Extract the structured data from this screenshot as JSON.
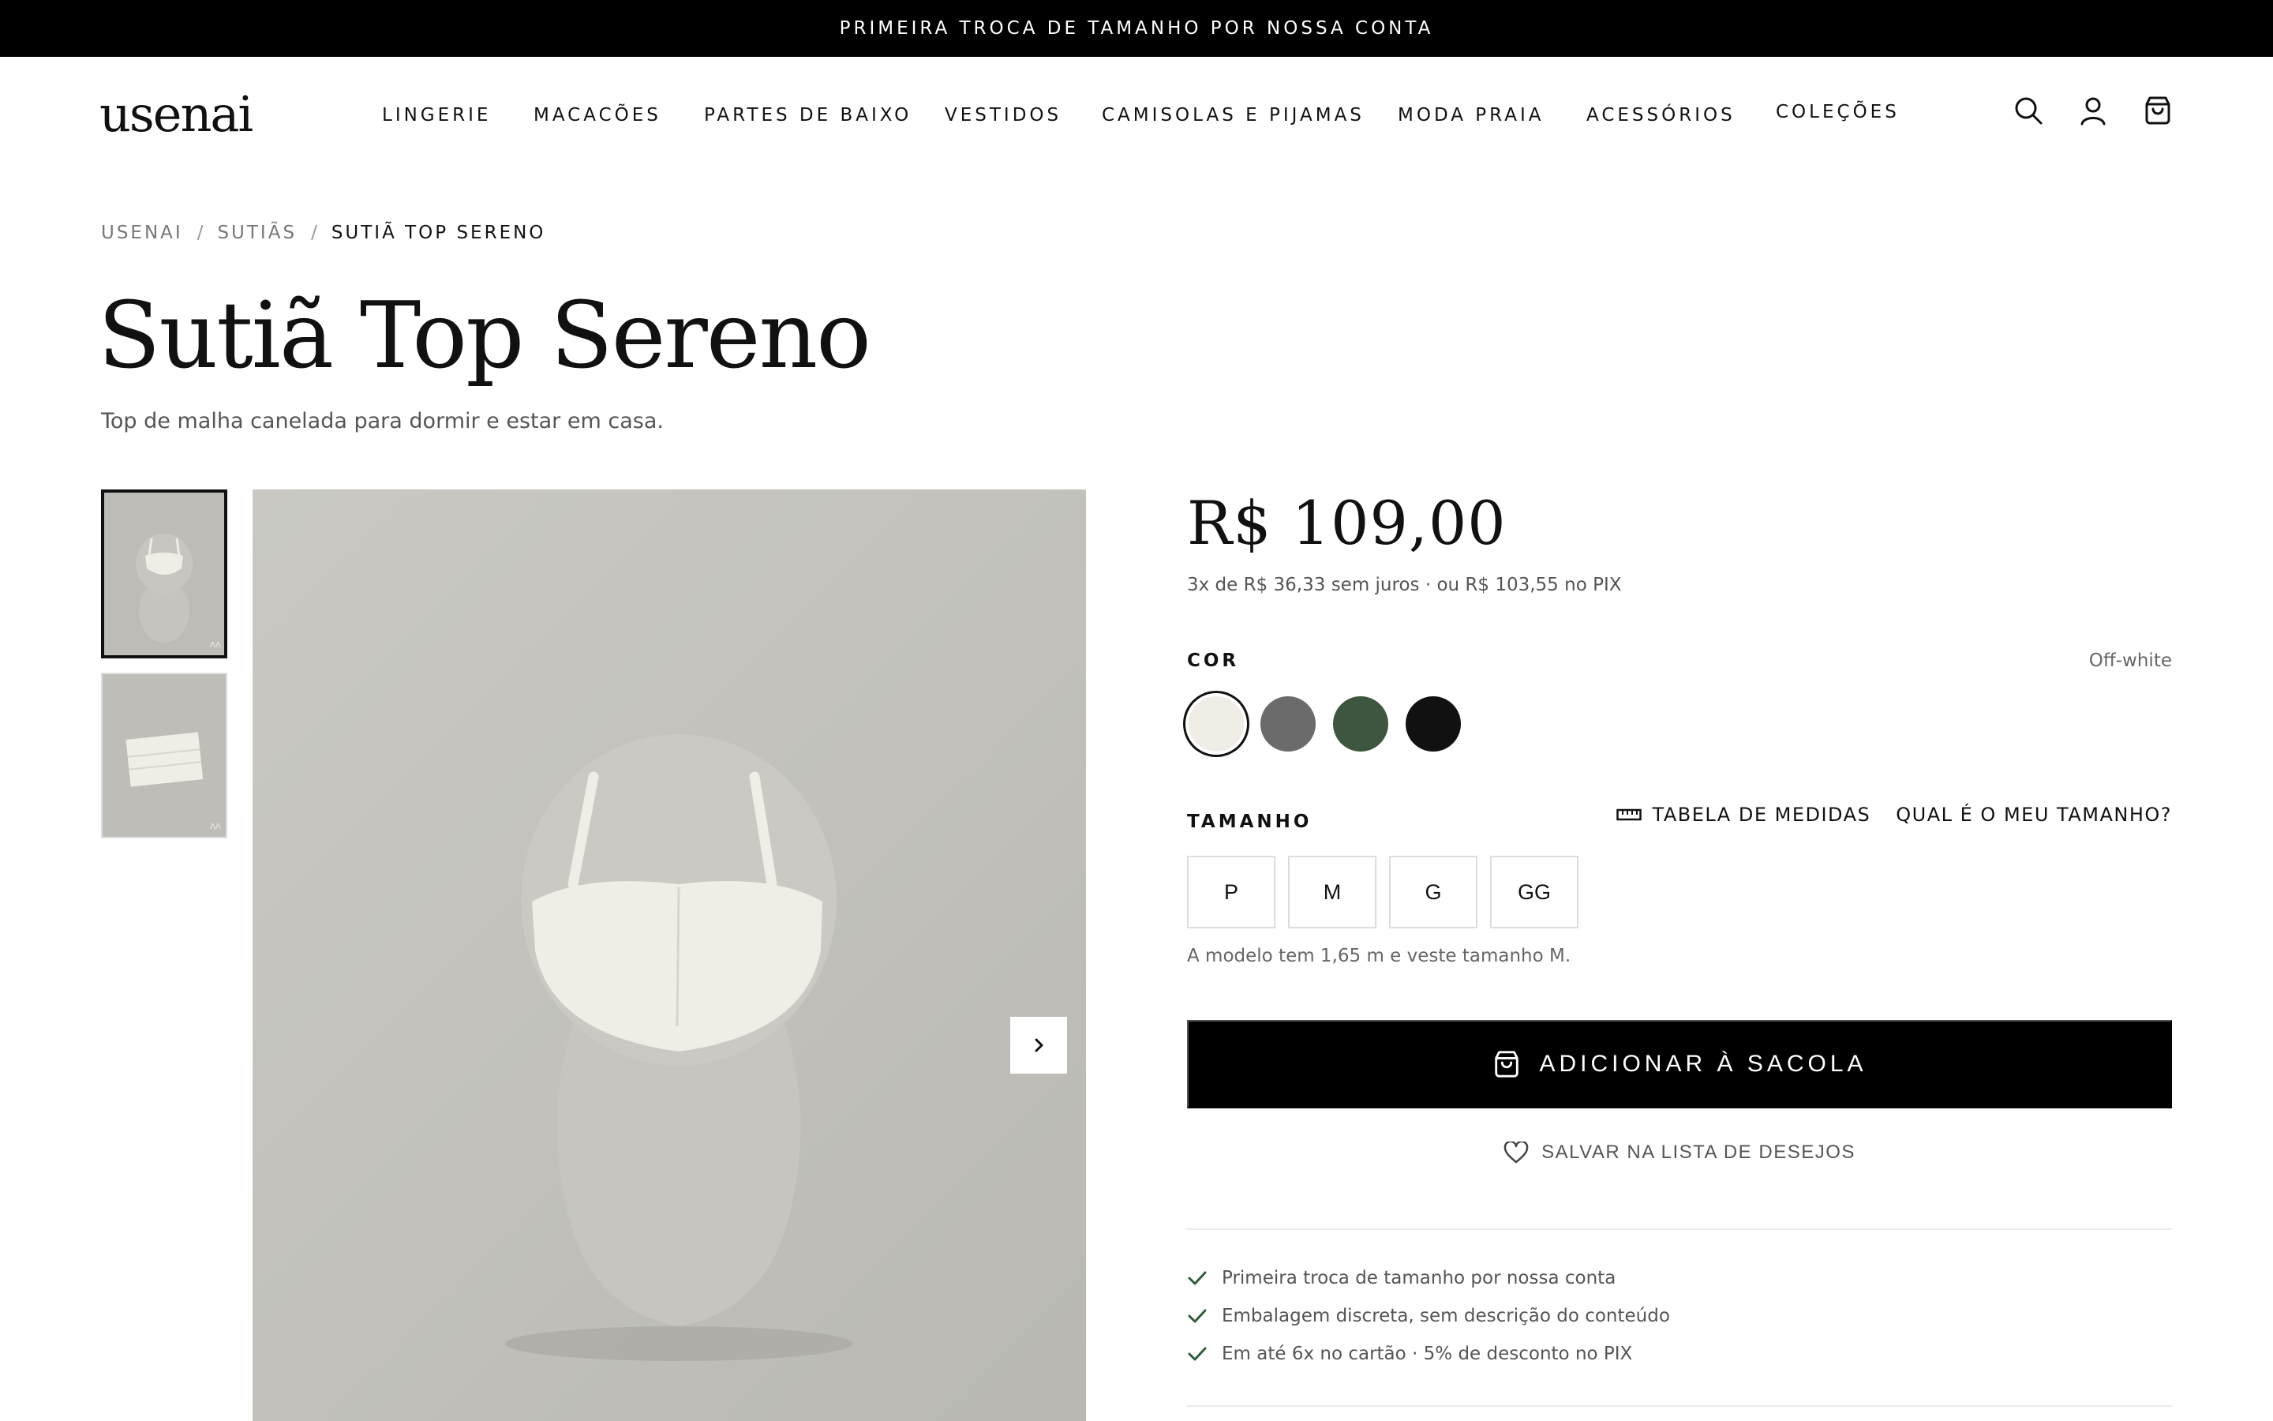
{
  "announcement": "PRIMEIRA TROCA DE TAMANHO POR NOSSA CONTA",
  "logo": "usenai",
  "nav": [
    "LINGERIE",
    "MACACÕES",
    "PARTES DE BAIXO",
    "VESTIDOS",
    "CAMISOLAS E PIJAMAS",
    "MODA PRAIA",
    "ACESSÓRIOS",
    "COLEÇÕES"
  ],
  "header_icons": [
    "search-icon",
    "account-icon",
    "bag-icon"
  ],
  "breadcrumb": {
    "items": [
      "USENAI",
      "SUTIÃS",
      "SUTIÃ TOP SERENO"
    ],
    "separator": "/"
  },
  "product": {
    "title": "Sutiã Top Sereno",
    "subtitle": "Top de malha canelada para dormir e estar em casa.",
    "price": "R$ 109,00",
    "installments": "3x de R$ 36,33 sem juros · ou R$ 103,55 no PIX"
  },
  "color": {
    "label": "COR",
    "selected_name": "Off-white",
    "swatches": [
      {
        "name": "Off-white",
        "hex": "#efede6",
        "selected": true
      },
      {
        "name": "Cinza",
        "hex": "#6b6b6b",
        "selected": false
      },
      {
        "name": "Verde",
        "hex": "#3e5640",
        "selected": false
      },
      {
        "name": "Preto",
        "hex": "#111111",
        "selected": false
      }
    ]
  },
  "size": {
    "label": "TAMANHO",
    "chart_link": "TABELA DE MEDIDAS",
    "finder_link": "QUAL É O MEU TAMANHO?",
    "options": [
      "P",
      "M",
      "G",
      "GG"
    ],
    "model_note": "A modelo tem 1,65 m e veste tamanho M."
  },
  "actions": {
    "add_to_bag": "ADICIONAR À SACOLA",
    "wishlist": "SALVAR NA LISTA DE DESEJOS"
  },
  "benefits": [
    "Primeira troca de tamanho por nossa conta",
    "Embalagem discreta, sem descrição do conteúdo",
    "Em até 6x no cartão · 5% de desconto no PIX"
  ],
  "colors": {
    "accent": "#000000",
    "check": "#2f5d3a",
    "image_bg": "#c4c3bd"
  }
}
